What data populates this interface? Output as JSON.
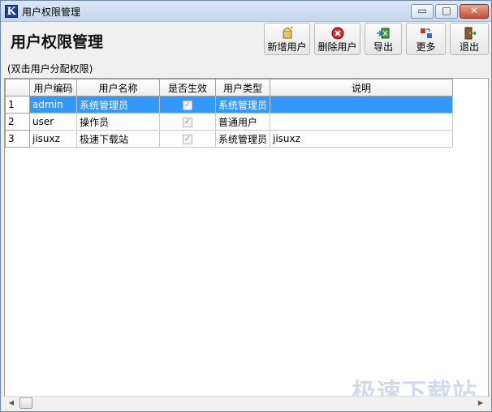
{
  "window": {
    "icon_letter": "K",
    "title": "用户权限管理",
    "min_glyph": "▭",
    "max_glyph": "□",
    "close_glyph": "✕"
  },
  "header": {
    "title": "用户权限管理",
    "buttons": {
      "add": {
        "label": "新增用户",
        "icon": "add-user-icon"
      },
      "delete": {
        "label": "删除用户",
        "icon": "delete-icon"
      },
      "export": {
        "label": "导出",
        "icon": "export-icon"
      },
      "more": {
        "label": "更多",
        "icon": "more-icon"
      },
      "exit": {
        "label": "退出",
        "icon": "exit-icon"
      }
    }
  },
  "hint": "(双击用户分配权限)",
  "grid": {
    "columns": [
      "用户编码",
      "用户名称",
      "是否生效",
      "用户类型",
      "说明"
    ],
    "rows": [
      {
        "n": "1",
        "code": "admin",
        "name": "系统管理员",
        "active": true,
        "type": "系统管理员",
        "desc": ""
      },
      {
        "n": "2",
        "code": "user",
        "name": "操作员",
        "active": true,
        "type": "普通用户",
        "desc": ""
      },
      {
        "n": "3",
        "code": "jisuxz",
        "name": "极速下载站",
        "active": true,
        "type": "系统管理员",
        "desc": "jisuxz"
      }
    ]
  },
  "watermark": "极速下载站",
  "colors": {
    "selection": "#3399ff",
    "close": "#c7502f",
    "titlebar": "#c4d6ec"
  }
}
